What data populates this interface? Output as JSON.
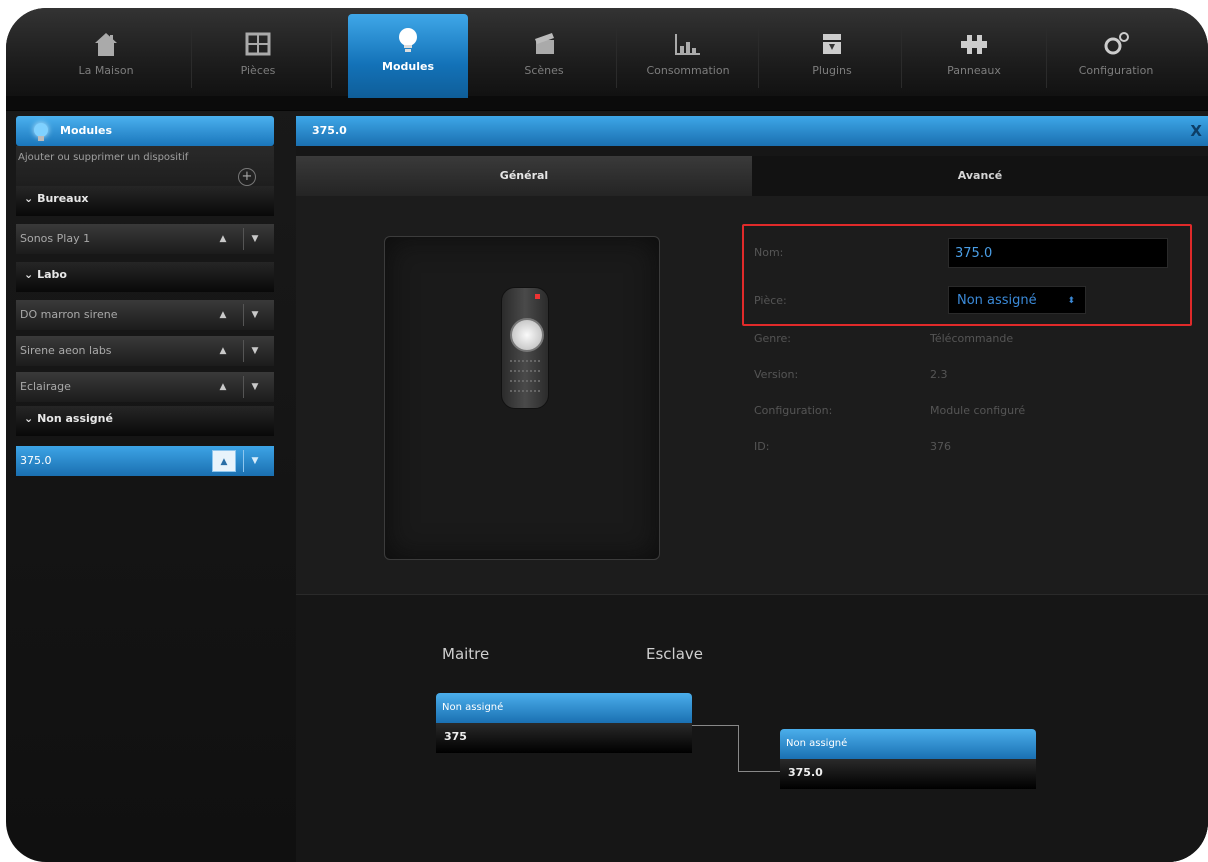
{
  "nav": {
    "items": [
      {
        "label": "La Maison",
        "icon": "house-icon"
      },
      {
        "label": "Pièces",
        "icon": "rooms-icon"
      },
      {
        "label": "Modules",
        "icon": "lightbulb-icon",
        "active": true
      },
      {
        "label": "Scènes",
        "icon": "clapperboard-icon"
      },
      {
        "label": "Consommation",
        "icon": "bar-chart-icon"
      },
      {
        "label": "Plugins",
        "icon": "plugin-box-icon"
      },
      {
        "label": "Panneaux",
        "icon": "panels-icon"
      },
      {
        "label": "Configuration",
        "icon": "gears-icon"
      }
    ]
  },
  "sidebar": {
    "title": "Modules",
    "add_text": "Ajouter ou supprimer un dispositif",
    "add_symbol": "+",
    "groups": [
      {
        "name": "Bureaux",
        "items": [
          "Sonos Play 1"
        ]
      },
      {
        "name": "Labo",
        "items": [
          "DO marron sirene",
          "Sirene aeon labs",
          "Eclairage"
        ]
      },
      {
        "name": "Non assigné",
        "items": [
          "375.0"
        ]
      }
    ],
    "group_caret": "⌄",
    "arrow_up": "▲",
    "arrow_down": "▼"
  },
  "panel": {
    "title": "375.0",
    "close": "X",
    "tabs": {
      "general": "Général",
      "advanced": "Avancé"
    },
    "fields": {
      "nom_label": "Nom:",
      "nom_value": "375.0",
      "piece_label": "Pièce:",
      "piece_value": "Non assigné",
      "piece_arrow": "⬍",
      "genre_label": "Genre:",
      "genre_value": "Télécommande",
      "version_label": "Version:",
      "version_value": "2.3",
      "config_label": "Configuration:",
      "config_value": "Module configuré",
      "id_label": "ID:",
      "id_value": "376"
    },
    "association": {
      "master_label": "Maitre",
      "slave_label": "Esclave",
      "master_node": {
        "header": "Non assigné",
        "value": "375"
      },
      "slave_node": {
        "header": "Non assigné",
        "value": "375.0"
      }
    }
  },
  "colors": {
    "accent_blue": "#1a76bb",
    "highlight_red": "#e02a2a"
  }
}
